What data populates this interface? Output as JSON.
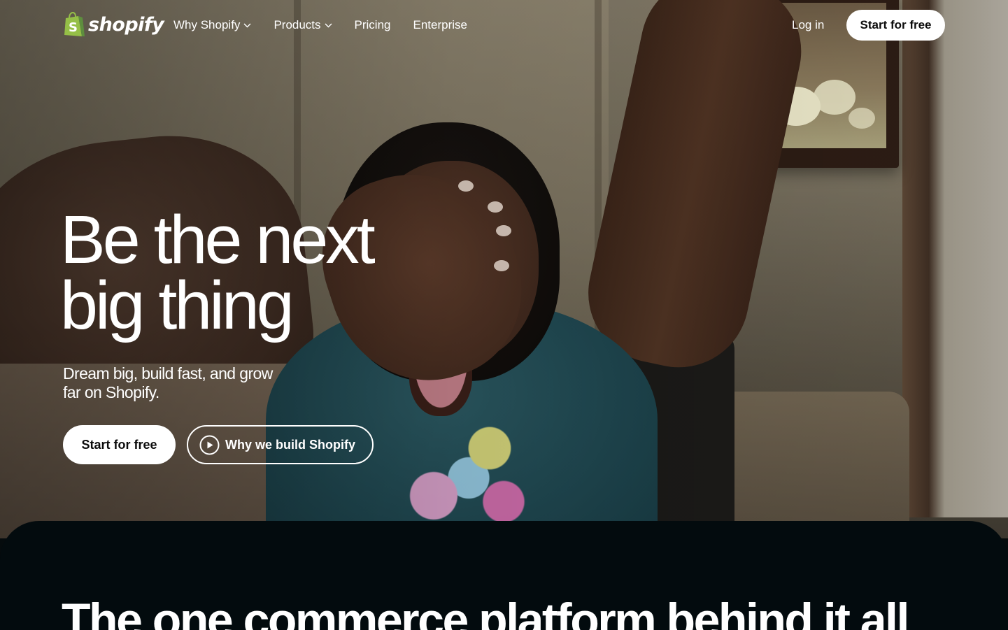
{
  "brand": {
    "name": "shopify",
    "logo_color": "#95bf47",
    "logo_dark_color": "#5e8e3e"
  },
  "nav": {
    "items": [
      {
        "label": "Why Shopify",
        "has_dropdown": true,
        "icon": "chevron-down-icon"
      },
      {
        "label": "Products",
        "has_dropdown": true,
        "icon": "chevron-down-icon"
      },
      {
        "label": "Pricing",
        "has_dropdown": false
      },
      {
        "label": "Enterprise",
        "has_dropdown": false
      }
    ],
    "login_label": "Log in",
    "cta_label": "Start for free"
  },
  "hero": {
    "headline_line1": "Be the next",
    "headline_line2": "big thing",
    "subhead": "Dream big, build fast, and grow far on Shopify.",
    "primary_cta": "Start for free",
    "secondary_cta": "Why we build Shopify",
    "secondary_cta_icon": "play-circle-icon"
  },
  "section": {
    "title": "The one commerce platform behind it all",
    "background": "#030b0e"
  }
}
